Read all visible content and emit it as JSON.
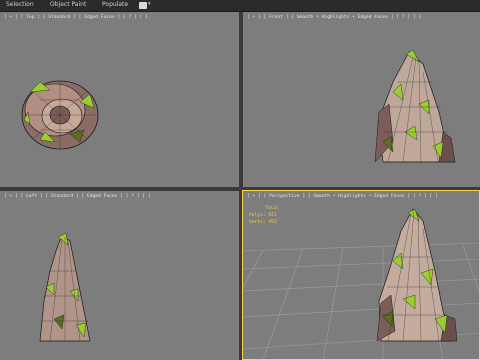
{
  "menu": {
    "items": [
      "Selection",
      "Object Paint",
      "Populate"
    ],
    "dropdown_glyph": "▾"
  },
  "viewports": {
    "top_left": {
      "label": "[ + ] [ Top ] [ Standard ] [ Edged Faces ] [ ? ] [ ]"
    },
    "top_right": {
      "label": "[ + ] [ Front ] [ Smooth + Highlights + Edged Faces ] [ ? ] [ ]"
    },
    "bottom_left": {
      "label": "[ + ] [ Left ] [ Standard ] [ Edged Faces ] [ ? ] [ ]"
    },
    "bottom_right": {
      "label": "[ + ] [ Perspective ] [ Smooth + Highlights + Edged Faces ] [ ? ] [ ]"
    }
  },
  "stats": {
    "total_label": "Total",
    "polys_label": "Polys:",
    "polys_value": "921",
    "verts_label": "Verts:",
    "verts_value": "453"
  },
  "colors": {
    "viewport_bg": "#7d7d7d",
    "active_border": "#ffd54a",
    "rock_base": "#8a6b66",
    "moss": "#9acd2f",
    "stats_text": "#f0d34a"
  }
}
